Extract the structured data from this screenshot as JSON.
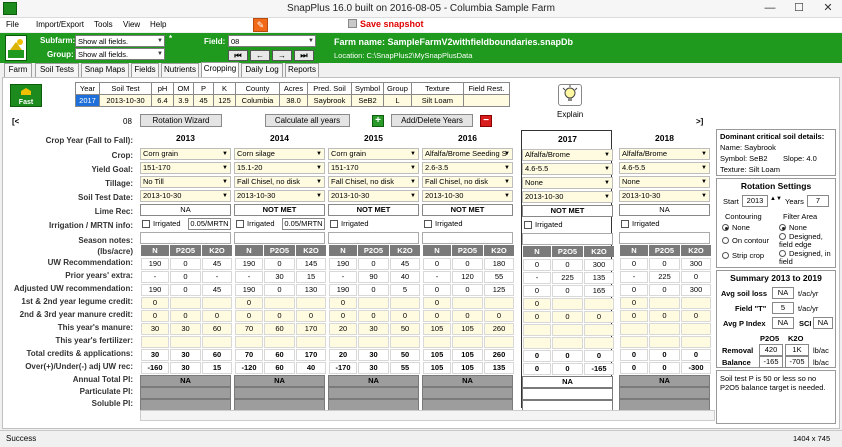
{
  "window": {
    "title": "SnapPlus 16.0 built on 2016-08-05 - Columbia Sample Farm",
    "min": "—",
    "max": "☐",
    "close": "✕"
  },
  "menu": [
    "File",
    "Import/Export",
    "Tools",
    "View",
    "Help"
  ],
  "save_snapshot": "Save snapshot",
  "filters": {
    "subfarm_label": "Subfarm:",
    "subfarm_value": "Show all fields.",
    "group_label": "Group:",
    "group_value": "Show all fields.",
    "field_label": "Field:",
    "field_value": "08",
    "star": "*"
  },
  "farm": {
    "name": "Farm name: SampleFarmV2withfieldboundaries.snapDb",
    "location": "Location: C:\\SnapPlus2\\MySnapPlusData"
  },
  "tabs": [
    "Farm",
    "Soil Tests",
    "Snap Maps",
    "Fields",
    "Nutrients",
    "Cropping",
    "Daily Log",
    "Reports"
  ],
  "active_tab": "Cropping",
  "fast_facts": "Fast Facts",
  "soil_table": {
    "headers": [
      "Year",
      "Soil Test",
      "pH",
      "OM",
      "P",
      "K",
      "County",
      "Acres",
      "Pred. Soil",
      "Symbol",
      "Group",
      "Texture",
      "Field Rest."
    ],
    "values": [
      "2017",
      "2013-10-30",
      "6.4",
      "3.9",
      "45",
      "125",
      "Columbia",
      "38.0",
      "Saybrook",
      "SeB2",
      "L",
      "Silt Loam",
      ""
    ]
  },
  "explain": "Explain",
  "field_id": "08",
  "buttons": {
    "nav_left": "[<",
    "rotation_wizard": "Rotation Wizard",
    "calc_all": "Calculate all years",
    "add_delete": "Add/Delete Years",
    "plus": "+",
    "minus": "−",
    "nav_right": ">]"
  },
  "row_labels": {
    "crop_year": "Crop Year (Fall to Fall):",
    "crop": "Crop:",
    "yield": "Yield Goal:",
    "tillage": "Tillage:",
    "soil_test_date": "Soil Test Date:",
    "lime": "Lime Rec:",
    "irrigation": "Irrigation / MRTN info:",
    "season_notes": "Season notes:",
    "lbs_acre": "(lbs/acre)",
    "uw_rec": "UW Recommendation:",
    "prior_extra": "Prior years' extra:",
    "adjusted": "Adjusted UW recommendation:",
    "legume": "1st & 2nd year legume credit:",
    "manure_credit": "2nd & 3rd year manure credit:",
    "this_manure": "This year's manure:",
    "this_fert": "This year's fertilizer:",
    "total_credits": "Total credits & applications:",
    "over_under": "Over(+)/Under(-) adj UW rec:",
    "annual_pi": "Annual Total PI:",
    "particulate_pi": "Particulate PI:",
    "soluble_pi": "Soluble PI:"
  },
  "nk": [
    "N",
    "P2O5",
    "K2O"
  ],
  "irrigated": "Irrigated",
  "years": [
    {
      "year": "2013",
      "crop": "Corn grain",
      "yield": "151-170",
      "tillage": "No Till",
      "date": "2013-10-30",
      "lime": "NA",
      "mrtn": "0.05/MRTN",
      "uw": [
        "190",
        "0",
        "45"
      ],
      "prior": [
        "-",
        "0",
        "-"
      ],
      "adj": [
        "190",
        "0",
        "45"
      ],
      "legume": [
        "0",
        "",
        ""
      ],
      "manure_cr": [
        "0",
        "0",
        "0"
      ],
      "manure": [
        "30",
        "30",
        "60"
      ],
      "fert": [
        "",
        "",
        ""
      ],
      "total": [
        "30",
        "30",
        "60"
      ],
      "over": [
        "-160",
        "30",
        "15"
      ],
      "annual_pi": "NA",
      "part_pi": "",
      "sol_pi": ""
    },
    {
      "year": "2014",
      "crop": "Corn silage",
      "yield": "15.1-20",
      "tillage": "Fall Chisel, no disk",
      "date": "2013-10-30",
      "lime": "NOT MET",
      "mrtn": "0.05/MRTN",
      "uw": [
        "190",
        "0",
        "145"
      ],
      "prior": [
        "-",
        "30",
        "15"
      ],
      "adj": [
        "190",
        "0",
        "130"
      ],
      "legume": [
        "0",
        "",
        ""
      ],
      "manure_cr": [
        "0",
        "0",
        "0"
      ],
      "manure": [
        "70",
        "60",
        "170"
      ],
      "fert": [
        "",
        "",
        ""
      ],
      "total": [
        "70",
        "60",
        "170"
      ],
      "over": [
        "-120",
        "60",
        "40"
      ],
      "annual_pi": "NA",
      "part_pi": "",
      "sol_pi": ""
    },
    {
      "year": "2015",
      "crop": "Corn grain",
      "yield": "151-170",
      "tillage": "Fall Chisel, no disk",
      "date": "2013-10-30",
      "lime": "NOT MET",
      "mrtn": "",
      "uw": [
        "190",
        "0",
        "45"
      ],
      "prior": [
        "-",
        "90",
        "40"
      ],
      "adj": [
        "190",
        "0",
        "5"
      ],
      "legume": [
        "0",
        "",
        ""
      ],
      "manure_cr": [
        "0",
        "0",
        "0"
      ],
      "manure": [
        "20",
        "30",
        "50"
      ],
      "fert": [
        "",
        "",
        ""
      ],
      "total": [
        "20",
        "30",
        "50"
      ],
      "over": [
        "-170",
        "30",
        "55"
      ],
      "annual_pi": "NA",
      "part_pi": "",
      "sol_pi": ""
    },
    {
      "year": "2016",
      "crop": "Alfalfa/Brome Seeding S",
      "yield": "2.6-3.5",
      "tillage": "Fall Chisel, no disk",
      "date": "2013-10-30",
      "lime": "NOT MET",
      "mrtn": "",
      "uw": [
        "0",
        "0",
        "180"
      ],
      "prior": [
        "-",
        "120",
        "55"
      ],
      "adj": [
        "0",
        "0",
        "125"
      ],
      "legume": [
        "0",
        "",
        ""
      ],
      "manure_cr": [
        "0",
        "0",
        "0"
      ],
      "manure": [
        "105",
        "105",
        "260"
      ],
      "fert": [
        "",
        "",
        ""
      ],
      "total": [
        "105",
        "105",
        "260"
      ],
      "over": [
        "105",
        "105",
        "135"
      ],
      "annual_pi": "NA",
      "part_pi": "",
      "sol_pi": ""
    },
    {
      "year": "2017",
      "crop": "Alfalfa/Brome",
      "yield": "4.6-5.5",
      "tillage": "None",
      "date": "2013-10-30",
      "lime": "NOT MET",
      "mrtn": "",
      "uw": [
        "0",
        "0",
        "300"
      ],
      "prior": [
        "-",
        "225",
        "135"
      ],
      "adj": [
        "0",
        "0",
        "165"
      ],
      "legume": [
        "0",
        "",
        ""
      ],
      "manure_cr": [
        "0",
        "0",
        "0"
      ],
      "manure": [
        "",
        "",
        ""
      ],
      "fert": [
        "",
        "",
        ""
      ],
      "total": [
        "0",
        "0",
        "0"
      ],
      "over": [
        "0",
        "0",
        "-165"
      ],
      "annual_pi": "NA",
      "part_pi": "",
      "sol_pi": ""
    },
    {
      "year": "2018",
      "crop": "Alfalfa/Brome",
      "yield": "4.6-5.5",
      "tillage": "None",
      "date": "2013-10-30",
      "lime": "NA",
      "mrtn": "",
      "uw": [
        "0",
        "0",
        "300"
      ],
      "prior": [
        "-",
        "225",
        "0"
      ],
      "adj": [
        "0",
        "0",
        "300"
      ],
      "legume": [
        "0",
        "",
        ""
      ],
      "manure_cr": [
        "0",
        "0",
        "0"
      ],
      "manure": [
        "",
        "",
        ""
      ],
      "fert": [
        "",
        "",
        ""
      ],
      "total": [
        "0",
        "0",
        "0"
      ],
      "over": [
        "0",
        "0",
        "-300"
      ],
      "annual_pi": "NA",
      "part_pi": "",
      "sol_pi": ""
    }
  ],
  "dominant": {
    "title": "Dominant critical soil details:",
    "name": "Name:  Saybrook",
    "symbol": "Symbol:  SeB2",
    "slope": "Slope:  4.0",
    "texture": "Texture:  Silt Loam"
  },
  "rotation": {
    "title": "Rotation Settings",
    "start_label": "Start",
    "start": "2013",
    "years_label": "Years",
    "years": "7",
    "contouring_label": "Contouring",
    "contouring": [
      "None",
      "On contour",
      "Strip crop"
    ],
    "filter_label": "Filter Area",
    "filter": [
      "None",
      "Designed, field edge",
      "Designed, in field"
    ]
  },
  "summary": {
    "title": "Summary  2013 to 2019",
    "avg_soil_loss_label": "Avg soil loss",
    "avg_soil_loss": "NA",
    "soil_unit": "t/ac/yr",
    "field_t_label": "Field \"T\"",
    "field_t": "5",
    "avg_p_label": "Avg P Index",
    "avg_p": "NA",
    "sci_label": "SCI",
    "sci": "NA",
    "p2o5": "P2O5",
    "k2o": "K2O",
    "removal_label": "Removal",
    "removal": [
      "420",
      "1K"
    ],
    "balance_label": "Balance",
    "balance": [
      "-165",
      "-705"
    ],
    "unit": "lb/ac",
    "note": "Soil test P is 50 or less so no P2O5 balance target is needed."
  },
  "status": {
    "text": "Success",
    "size": "1404 x 745"
  }
}
